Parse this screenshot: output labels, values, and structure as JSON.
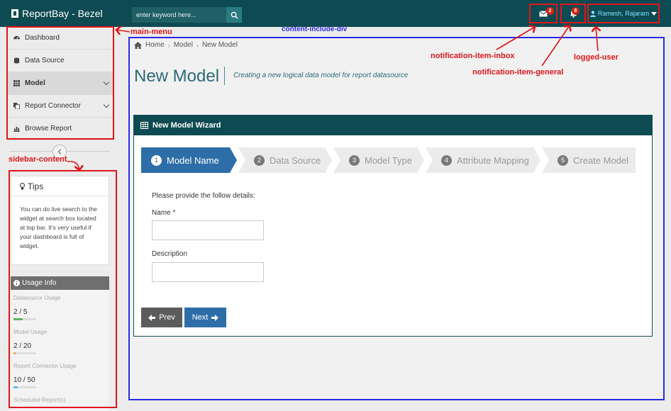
{
  "app": {
    "title": "ReportBay - Bezel"
  },
  "search": {
    "placeholder": "enter keyword here..."
  },
  "topnav": {
    "inbox_count": "2",
    "general_count": "8",
    "user_name": "Ramesh, Rajaram"
  },
  "sidebar": {
    "menu": [
      {
        "label": "Dashboard",
        "icon": "dashboard-icon"
      },
      {
        "label": "Data Source",
        "icon": "database-icon"
      },
      {
        "label": "Model",
        "icon": "table-icon"
      },
      {
        "label": "Report Connector",
        "icon": "copy-icon"
      },
      {
        "label": "Browse Report",
        "icon": "bar-chart-icon"
      }
    ],
    "tips": {
      "title": "Tips",
      "text": "You can do live search to the widget at search box located at top bar. It's very useful if your dashboard is full of widget."
    },
    "usage": {
      "title": "Usage Info",
      "items": [
        {
          "label": "Datasource Usage",
          "value": "2 / 5",
          "fraction": 0.4,
          "color": "#5cb85c"
        },
        {
          "label": "Model Usage",
          "value": "2 / 20",
          "fraction": 0.1,
          "color": "#f0ad4e"
        },
        {
          "label": "Report Connector Usage",
          "value": "10 / 50",
          "fraction": 0.2,
          "color": "#5bc0de"
        },
        {
          "label": "Scheduled Report(s)",
          "value": "",
          "fraction": 0,
          "color": "#5bc0de"
        }
      ]
    }
  },
  "content": {
    "breadcrumb": [
      "Home",
      "Model",
      "New Model"
    ],
    "page_title": "New Model",
    "page_subtitle": "Creating a new logical data model for report datasource",
    "wizard": {
      "title": "New Model Wizard",
      "steps": [
        {
          "num": "1",
          "label": "Model Name"
        },
        {
          "num": "2",
          "label": "Data Source"
        },
        {
          "num": "3",
          "label": "Model Type"
        },
        {
          "num": "4",
          "label": "Attribute Mapping"
        },
        {
          "num": "5",
          "label": "Create Model"
        }
      ],
      "active_step": 1,
      "intro": "Please provide the follow details:",
      "name_label": "Name *",
      "name_value": "",
      "description_label": "Description",
      "description_value": "",
      "prev_label": "Prev",
      "next_label": "Next"
    }
  },
  "annotations": {
    "main_menu": "main-menu",
    "sidebar_content": "sidebar-content",
    "content_include_div": "content-include-div",
    "notification_item_inbox": "notification-item-inbox",
    "notification_item_general": "notification-item-general",
    "logged_user": "logged-user"
  },
  "colors": {
    "topbar": "#0e4a52",
    "accent": "#2e6ea8",
    "annotation_red": "#e0161b",
    "annotation_blue": "#2a2ae8"
  }
}
